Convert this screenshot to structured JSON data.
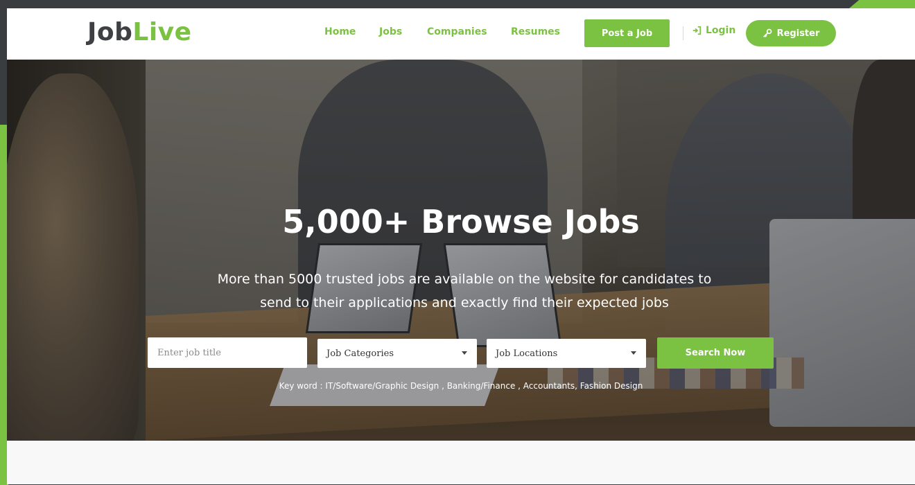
{
  "brand": {
    "logo_part1": "Job",
    "logo_part2": "Live"
  },
  "nav": {
    "items": [
      "Home",
      "Jobs",
      "Companies",
      "Resumes"
    ],
    "post_job": "Post a Job",
    "login": "Login",
    "register": "Register"
  },
  "hero": {
    "title": "5,000+ Browse Jobs",
    "subtitle_line1": "More than 5000 trusted jobs are available on the website for candidates to",
    "subtitle_line2": "send to their applications and exactly find their expected jobs"
  },
  "search": {
    "job_title_placeholder": "Enter job title",
    "categories_selected": "Job Categories",
    "locations_selected": "Job Locations",
    "button": "Search Now",
    "keywords": "Key word : IT/Software/Graphic Design , Banking/Finance , Accountants, Fashion Design"
  },
  "colors": {
    "accent": "#7cc242",
    "logo_dark": "#3f4043",
    "frame": "#3a3d40"
  },
  "icons": {
    "login": "sign-in-icon",
    "register": "key-icon",
    "dropdown": "caret-down-icon"
  }
}
